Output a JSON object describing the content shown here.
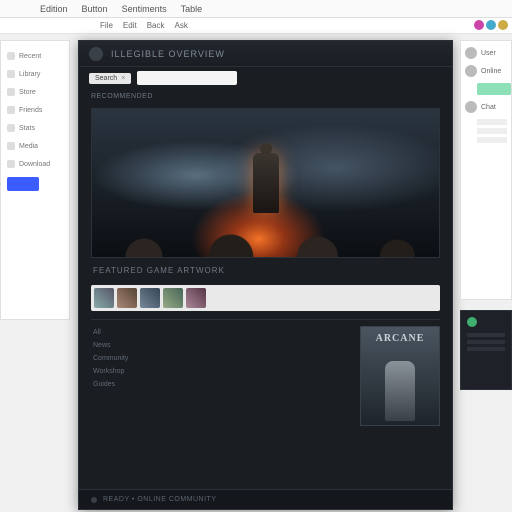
{
  "menubar": {
    "items": [
      "Edition",
      "Button",
      "Sentiments",
      "Table"
    ]
  },
  "toolbar2": {
    "items": [
      "File",
      "Edit",
      "Back",
      "Ask"
    ]
  },
  "left_panel": {
    "items": [
      "Recent",
      "Library",
      "Store",
      "Friends",
      "Stats",
      "Media",
      "Download"
    ]
  },
  "main": {
    "title": "Illegible Overview",
    "breadcrumb": {
      "chip": "Search"
    },
    "subheader": "Recommended",
    "caption": "Featured Game Artwork",
    "listing": {
      "header": "All",
      "rows": [
        "News",
        "Community",
        "Workshop",
        "Guides"
      ]
    },
    "side_card": {
      "logo": "ARCANE"
    },
    "footer": "Ready • Online Community"
  },
  "right_panel": {
    "rows": [
      {
        "label": "User"
      },
      {
        "label": "Online"
      },
      {
        "label": "Chat"
      }
    ]
  }
}
